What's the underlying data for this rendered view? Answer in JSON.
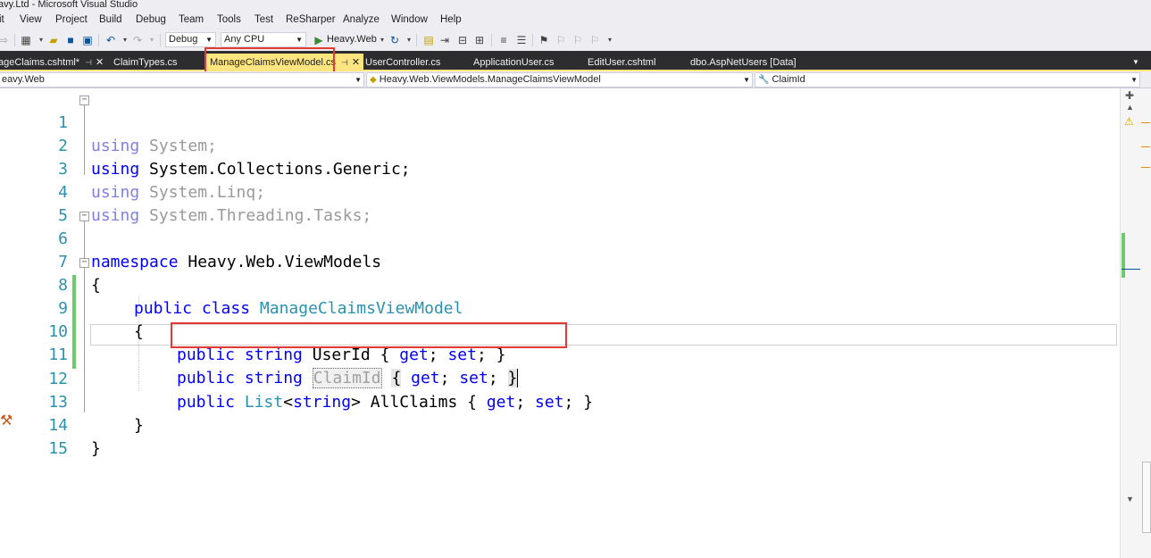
{
  "window": {
    "title": "avy.Ltd - Microsoft Visual Studio"
  },
  "menu": [
    "it",
    "View",
    "Project",
    "Build",
    "Debug",
    "Team",
    "Tools",
    "Test",
    "ReSharper",
    "Analyze",
    "Window",
    "Help"
  ],
  "toolbar": {
    "configuration": "Debug",
    "platform": "Any CPU",
    "start_label": "Heavy.Web"
  },
  "tabs": [
    {
      "label": "ageClaims.cshtml*",
      "pinned": true,
      "active": false
    },
    {
      "label": "ClaimTypes.cs",
      "active": false
    },
    {
      "label": "ManageClaimsViewModel.cs",
      "pinned": true,
      "active": true
    },
    {
      "label": "UserController.cs",
      "active": false
    },
    {
      "label": "ApplicationUser.cs",
      "active": false
    },
    {
      "label": "EditUser.cshtml",
      "active": false
    },
    {
      "label": "dbo.AspNetUsers [Data]",
      "active": false
    }
  ],
  "navbar": {
    "project": "eavy.Web",
    "class": "Heavy.Web.ViewModels.ManageClaimsViewModel",
    "member": "ClaimId"
  },
  "editor": {
    "line_numbers": [
      "1",
      "2",
      "3",
      "4",
      "5",
      "6",
      "7",
      "8",
      "9",
      "10",
      "11",
      "12",
      "13",
      "14",
      "15"
    ],
    "lines": {
      "l1_kw": "using",
      "l1_ns": " System;",
      "l2_kw": "using",
      "l2_ns": " System.Collections.Generic;",
      "l3_kw": "using",
      "l3_ns": " System.Linq;",
      "l4_kw": "using",
      "l4_ns": " System.Threading.Tasks;",
      "l6_kw": "namespace",
      "l6_ns": " Heavy.Web.ViewModels",
      "l7": "{",
      "l8_kw1": "public",
      "l8_kw2": " class",
      "l8_type": " ManageClaimsViewModel",
      "l9": "{",
      "l10_kw1": "public",
      "l10_kw2": " string",
      "l10_name": " UserId { ",
      "l10_get": "get",
      "l10_mid": "; ",
      "l10_set": "set",
      "l10_end": "; }",
      "l11_kw1": "public",
      "l11_kw2": " string",
      "l11_sp": " ",
      "l11_name": "ClaimId",
      "l11_sp2": " ",
      "l11_ob": "{",
      "l11_sp3": " ",
      "l11_get": "get",
      "l11_mid": "; ",
      "l11_set": "set",
      "l11_semi": "; ",
      "l11_cb": "}",
      "l12_kw1": "public",
      "l12_type": " List",
      "l12_lt": "<",
      "l12_kw2": "string",
      "l12_name": "> AllClaims { ",
      "l12_get": "get",
      "l12_mid": "; ",
      "l12_set": "set",
      "l12_end": "; }",
      "l13": "}",
      "l14": "}"
    }
  },
  "colors": {
    "keyword": "#0000ff",
    "type": "#2b91af",
    "active_tab": "#ffe57f",
    "annotation_box": "#e53935"
  }
}
